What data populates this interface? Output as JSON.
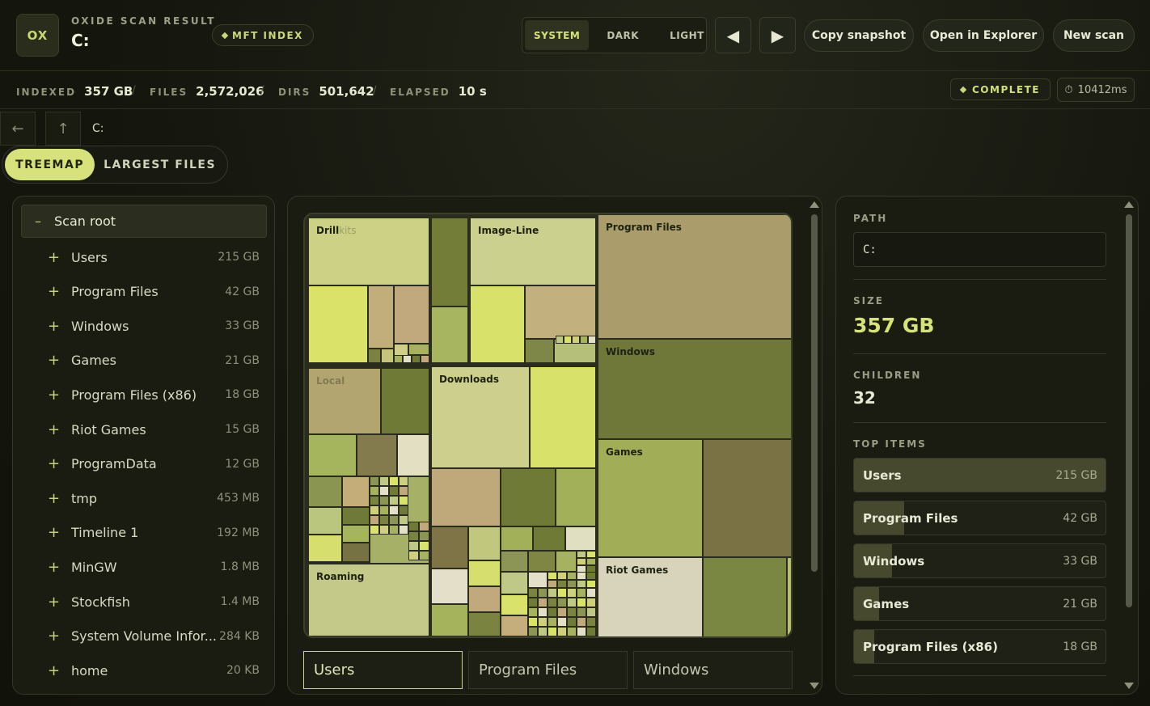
{
  "header": {
    "logo": "OX",
    "app_title": "OXIDE SCAN RESULT",
    "drive": "C:",
    "badge": "MFT INDEX",
    "themes": [
      "SYSTEM",
      "DARK",
      "LIGHT"
    ],
    "active_theme": "SYSTEM",
    "prev_icon": "◀",
    "next_icon": "▶",
    "copy_label": "Copy snapshot",
    "explorer_label": "Open in Explorer",
    "new_scan_label": "New scan"
  },
  "stats": {
    "indexed_label": "INDEXED",
    "indexed_value": "357 GB",
    "files_label": "FILES",
    "files_value": "2,572,026",
    "dirs_label": "DIRS",
    "dirs_value": "501,642",
    "elapsed_label": "ELAPSED",
    "elapsed_value": "10 s",
    "status": "COMPLETE",
    "duration": "10412ms",
    "separator": "/"
  },
  "breadcrumb": {
    "back_icon": "←",
    "up_icon": "↑",
    "path": "C:"
  },
  "view_tabs": {
    "treemap": "TREEMAP",
    "largest": "LARGEST FILES"
  },
  "tree": {
    "root_toggle": "–",
    "root_label": "Scan root",
    "expand_icon": "+",
    "items": [
      {
        "name": "Users",
        "size": "215 GB"
      },
      {
        "name": "Program Files",
        "size": "42 GB"
      },
      {
        "name": "Windows",
        "size": "33 GB"
      },
      {
        "name": "Games",
        "size": "21 GB"
      },
      {
        "name": "Program Files (x86)",
        "size": "18 GB"
      },
      {
        "name": "Riot Games",
        "size": "15 GB"
      },
      {
        "name": "ProgramData",
        "size": "12 GB"
      },
      {
        "name": "tmp",
        "size": "453 MB"
      },
      {
        "name": "Timeline 1",
        "size": "192 MB"
      },
      {
        "name": "MinGW",
        "size": "1.8 MB"
      },
      {
        "name": "Stockfish",
        "size": "1.4 MB"
      },
      {
        "name": "System Volume Infor...",
        "size": "284 KB"
      },
      {
        "name": "home",
        "size": "20 KB"
      }
    ]
  },
  "treemap": {
    "labels": {
      "drill": "Drill",
      "drill_suffix": "kits",
      "image_line": "Image-Line",
      "program_files": "Program Files",
      "local": "Local",
      "downloads": "Downloads",
      "windows": "Windows",
      "games": "Games",
      "roaming": "Roaming",
      "riot_games": "Riot Games"
    },
    "tabs": [
      "Users",
      "Program Files",
      "Windows"
    ]
  },
  "details": {
    "path_label": "PATH",
    "path_value": "C:",
    "size_label": "SIZE",
    "size_value": "357 GB",
    "children_label": "CHILDREN",
    "children_value": "32",
    "top_items_label": "TOP ITEMS",
    "top_items": [
      {
        "name": "Users",
        "size": "215 GB",
        "share": 1.0
      },
      {
        "name": "Program Files",
        "size": "42 GB",
        "share": 0.2
      },
      {
        "name": "Windows",
        "size": "33 GB",
        "share": 0.15
      },
      {
        "name": "Games",
        "size": "21 GB",
        "share": 0.1
      },
      {
        "name": "Program Files (x86)",
        "size": "18 GB",
        "share": 0.08
      }
    ]
  },
  "colors": {
    "accent": "#d8e27c",
    "bg": "#15170f",
    "panel": "#1a1c12"
  }
}
